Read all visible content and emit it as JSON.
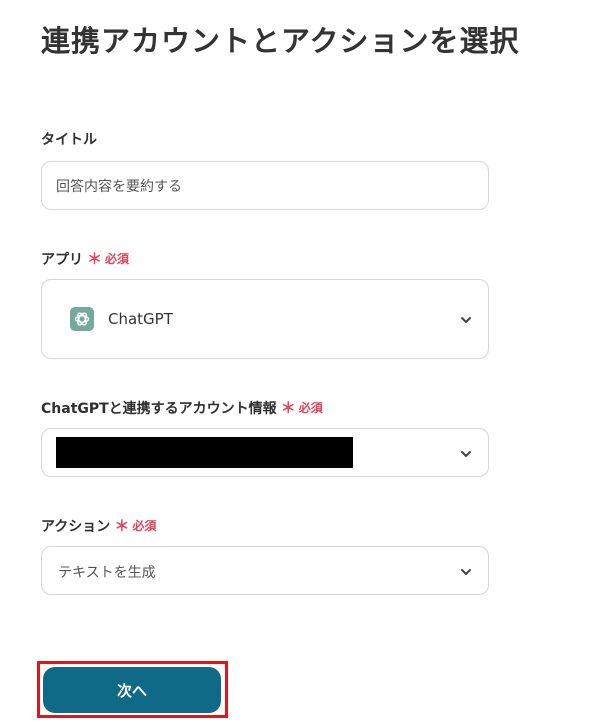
{
  "header": {
    "title": "連携アカウントとアクションを選択"
  },
  "form": {
    "title_field": {
      "label": "タイトル",
      "value": "回答内容を要約する"
    },
    "app_field": {
      "label": "アプリ",
      "required_mark": "＊",
      "required_text": "必須",
      "selected_app": "ChatGPT",
      "app_icon": "chatgpt-logo-icon"
    },
    "account_field": {
      "label": "ChatGPTと連携するアカウント情報",
      "required_mark": "＊",
      "required_text": "必須"
    },
    "action_field": {
      "label": "アクション",
      "required_mark": "＊",
      "required_text": "必須",
      "selected_action": "テキストを生成"
    }
  },
  "footer": {
    "next_label": "次へ"
  },
  "colors": {
    "primary_button": "#0f6a87",
    "required": "#e0445a",
    "highlight_border": "#e4141b",
    "app_logo_bg": "#74aa9c"
  }
}
